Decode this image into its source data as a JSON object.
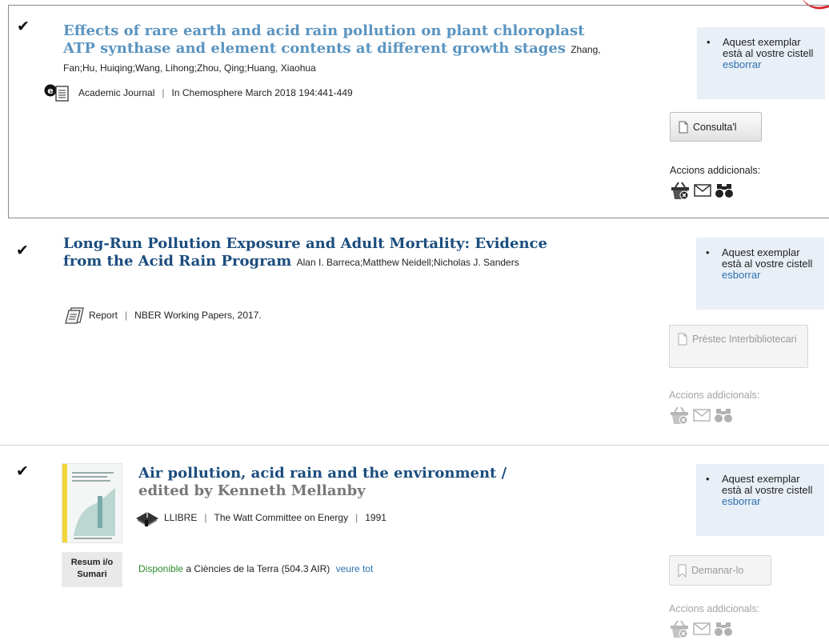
{
  "colors": {
    "link_light": "#5a94c0",
    "link_dark": "#1b4d7e",
    "cart_bg": "#e9eff7",
    "available": "#2d8a2d"
  },
  "records": [
    {
      "checked": true,
      "title": "Effects of rare earth and acid rain pollution on plant chloroplast ATP synthase and element contents at different growth stages",
      "authors": "Zhang, Fan;Hu, Huiqing;Wang, Lihong;Zhou, Qing;Huang, Xiaohua",
      "type_icon": "ejournal-icon",
      "format": "Academic Journal",
      "source": "In Chemosphere March 2018 194:441-449",
      "cart_status_prefix": "Aquest exemplar està al vostre cistell",
      "cart_remove_link": "esborrar",
      "action_button": "Consulta'l",
      "action_button_icon": "document-icon",
      "action_button_enabled": true,
      "more_actions_label": "Accions addicionals:",
      "more_actions_enabled": true
    },
    {
      "checked": true,
      "title": "Long-Run Pollution Exposure and Adult Mortality: Evidence from the Acid Rain Program",
      "authors": "Alan I. Barreca;Matthew Neidell;Nicholas J. Sanders",
      "type_icon": "report-icon",
      "format": "Report",
      "source": "NBER Working Papers, 2017.",
      "cart_status_prefix": "Aquest exemplar està al vostre cistell",
      "cart_remove_link": "esborrar",
      "action_button": "Préstec Interbibliotecari",
      "action_button_icon": "document-icon",
      "action_button_enabled": false,
      "more_actions_label": "Accions addicionals:",
      "more_actions_enabled": false
    },
    {
      "checked": true,
      "title": "Air pollution, acid rain and the environment",
      "title_sep": "/",
      "subtitle": "edited by Kenneth Mellanby",
      "type_icon": "book-icon",
      "format": "LLIBRE",
      "publisher": "The Watt Committee on Energy",
      "year": "1991",
      "thumbnail_label": "Resum i/o Sumari",
      "availability_status": "Disponible",
      "availability_text": "a Ciències de la Terra (504.3 AIR)",
      "see_all_link": "veure tot",
      "cart_status_prefix": "Aquest exemplar està al vostre cistell",
      "cart_remove_link": "esborrar",
      "action_button": "Demanar-lo",
      "action_button_icon": "bookmark-icon",
      "action_button_enabled": false,
      "more_actions_label": "Accions addicionals:",
      "more_actions_enabled": false
    }
  ],
  "action_icons": [
    "basket-remove-icon",
    "email-icon",
    "binoculars-icon"
  ]
}
